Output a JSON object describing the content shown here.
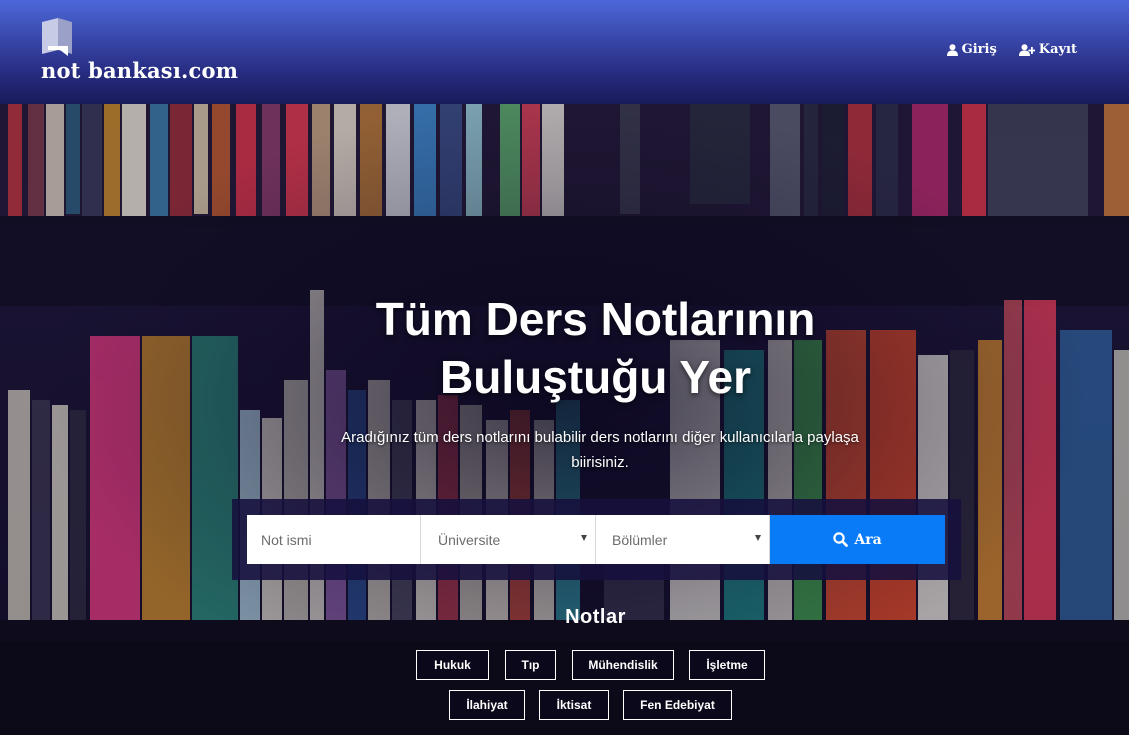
{
  "header": {
    "brand": "not bankası.com",
    "nav": [
      {
        "label": "Giriş",
        "icon": "user-icon"
      },
      {
        "label": "Kayıt",
        "icon": "user-plus-icon"
      }
    ]
  },
  "hero": {
    "title_line1": "Tüm Ders Notlarının",
    "title_line2": "Buluştuğu Yer",
    "subtitle_line1": "Aradığınız tüm ders notlarını bulabilir ders notlarını diğer kullanıcılarla paylaşa",
    "subtitle_line2": "biirisiniz."
  },
  "search": {
    "name_placeholder": "Not ismi",
    "university_selected": "Üniversite",
    "department_selected": "Bölümler",
    "button_label": "Ara",
    "button_icon": "search-icon"
  },
  "notes": {
    "title": "Notlar",
    "row1": [
      "Hukuk",
      "Tıp",
      "Mühendislik",
      "İşletme"
    ],
    "row2": [
      "İlahiyat",
      "İktisat",
      "Fen Edebiyat"
    ]
  },
  "colors": {
    "header_top": "#4c68d9",
    "header_bottom": "#1a1b5a",
    "search_button": "#0a7bf7",
    "search_panel": "#16103e"
  }
}
